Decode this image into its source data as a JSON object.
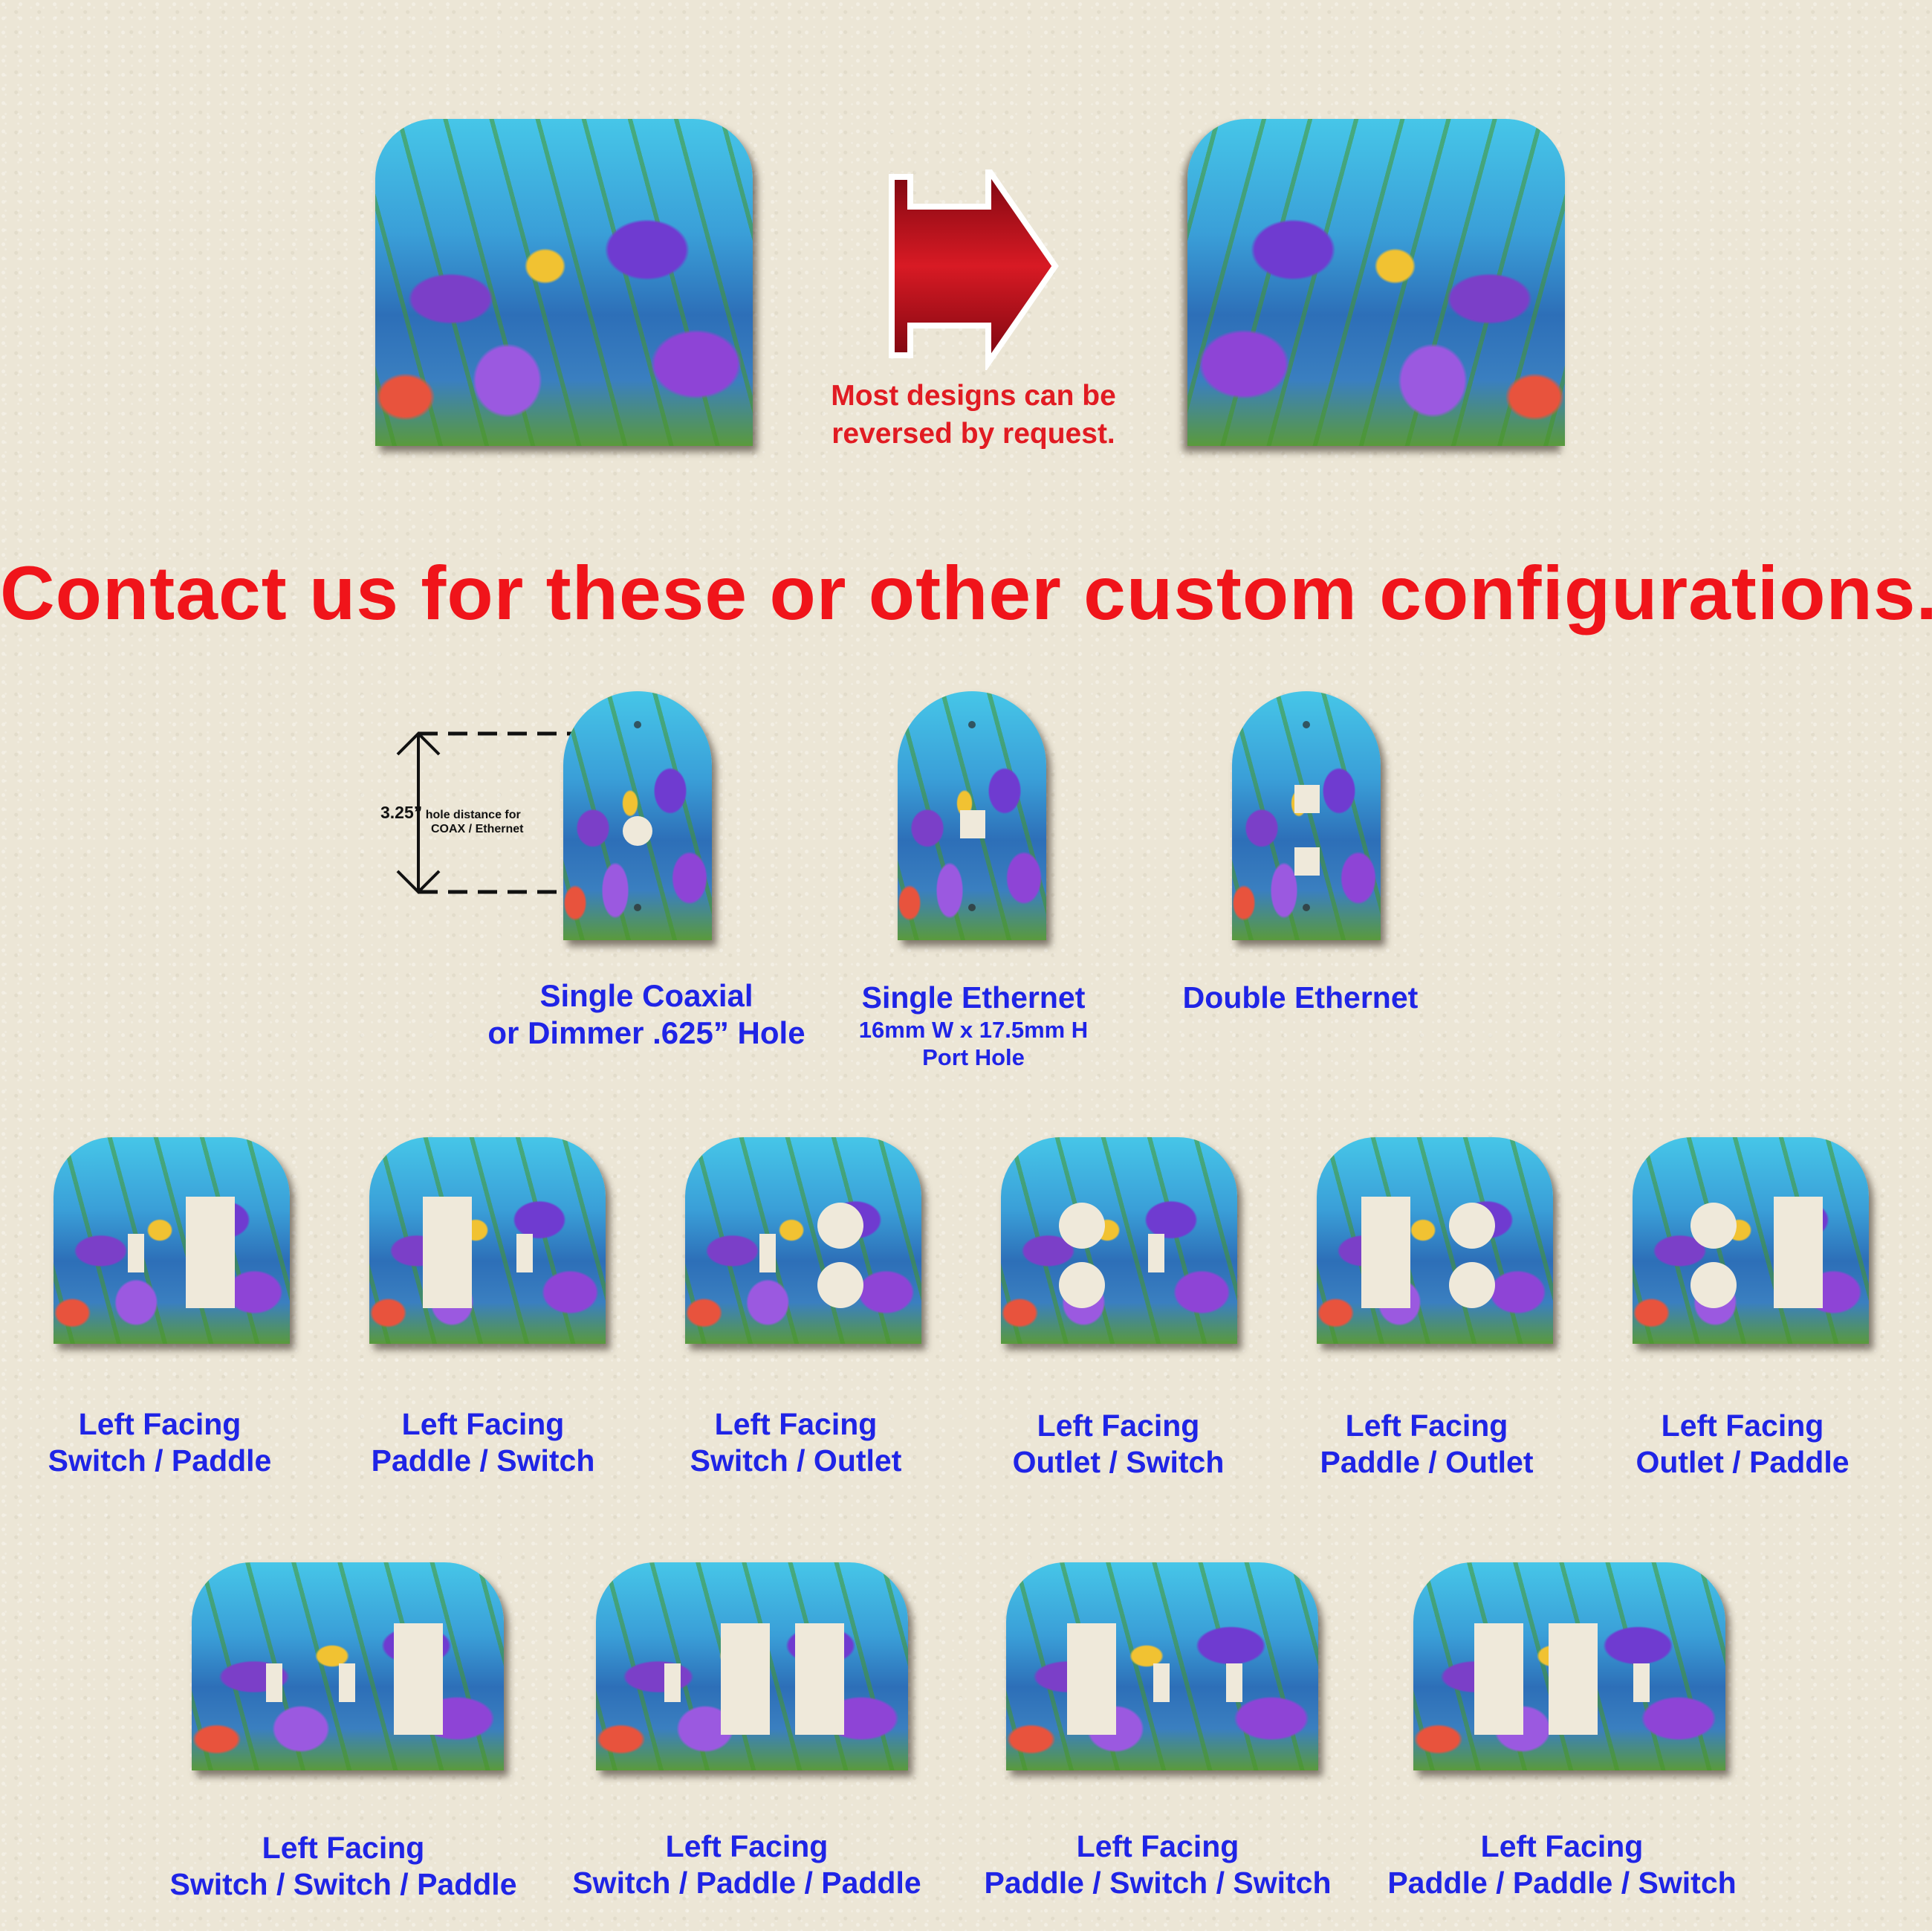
{
  "top": {
    "reverse_note_line1": "Most designs can be",
    "reverse_note_line2": "reversed by request.",
    "arrow_color": "#c8101a"
  },
  "headline": "Contact us for these or other custom configurations.",
  "dimension": {
    "value": "3.25”",
    "desc_line1": "hole distance for",
    "desc_line2": "COAX / Ethernet"
  },
  "singles": [
    {
      "line1": "Single Coaxial",
      "line2": "or Dimmer .625” Hole"
    },
    {
      "line1": "Single Ethernet",
      "line2": "16mm W x 17.5mm H",
      "line3": "Port Hole"
    },
    {
      "line1": "Double Ethernet"
    }
  ],
  "doubles": [
    {
      "line1": "Left Facing",
      "line2": "Switch / Paddle"
    },
    {
      "line1": "Left Facing",
      "line2": "Paddle / Switch"
    },
    {
      "line1": "Left Facing",
      "line2": "Switch / Outlet"
    },
    {
      "line1": "Left Facing",
      "line2": "Outlet / Switch"
    },
    {
      "line1": "Left Facing",
      "line2": "Paddle / Outlet"
    },
    {
      "line1": "Left Facing",
      "line2": "Outlet / Paddle"
    }
  ],
  "triples": [
    {
      "line1": "Left Facing",
      "line2": "Switch / Switch / Paddle"
    },
    {
      "line1": "Left Facing",
      "line2": "Switch / Paddle / Paddle"
    },
    {
      "line1": "Left Facing",
      "line2": "Paddle / Switch / Switch"
    },
    {
      "line1": "Left Facing",
      "line2": "Paddle / Paddle / Switch"
    }
  ],
  "colors": {
    "headline": "#f0141a",
    "caption": "#1f24e6",
    "background": "#ece6d6"
  }
}
